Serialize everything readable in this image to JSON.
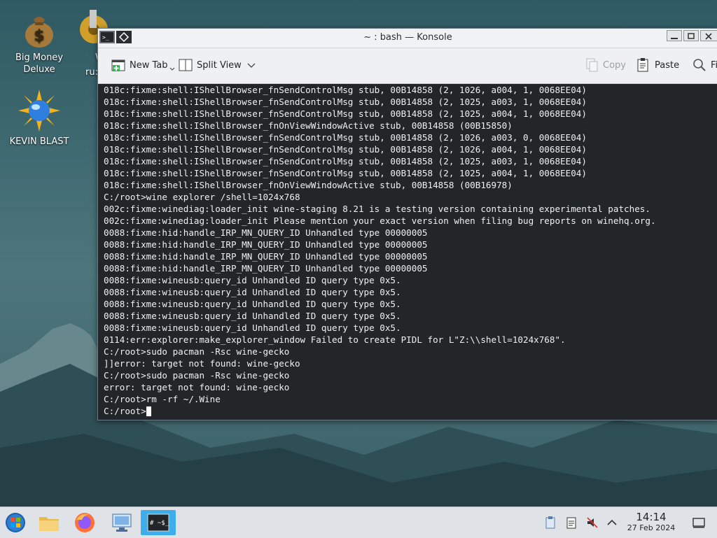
{
  "desktop": {
    "icons": [
      {
        "label_line1": "Big Money",
        "label_line2": "Deluxe"
      },
      {
        "label": "KEVIN BLAST"
      },
      {
        "label_partial": "W",
        "label_partial2": "ru:"
      }
    ]
  },
  "window": {
    "title": "~ : bash — Konsole",
    "toolbar": {
      "new_tab": "New Tab",
      "split_view": "Split View",
      "copy": "Copy",
      "paste": "Paste",
      "find": "Fi"
    }
  },
  "terminal": {
    "lines": [
      "018c:fixme:shell:IShellBrowser_fnSendControlMsg stub, 00B14858 (2, 1026, a004, 1, 0068EE04)",
      "018c:fixme:shell:IShellBrowser_fnSendControlMsg stub, 00B14858 (2, 1025, a003, 1, 0068EE04)",
      "018c:fixme:shell:IShellBrowser_fnSendControlMsg stub, 00B14858 (2, 1025, a004, 1, 0068EE04)",
      "018c:fixme:shell:IShellBrowser_fnOnViewWindowActive stub, 00B14858 (00B15850)",
      "018c:fixme:shell:IShellBrowser_fnSendControlMsg stub, 00B14858 (2, 1026, a003, 0, 0068EE04)",
      "018c:fixme:shell:IShellBrowser_fnSendControlMsg stub, 00B14858 (2, 1026, a004, 1, 0068EE04)",
      "018c:fixme:shell:IShellBrowser_fnSendControlMsg stub, 00B14858 (2, 1025, a003, 1, 0068EE04)",
      "018c:fixme:shell:IShellBrowser_fnSendControlMsg stub, 00B14858 (2, 1025, a004, 1, 0068EE04)",
      "018c:fixme:shell:IShellBrowser_fnOnViewWindowActive stub, 00B14858 (00B16978)",
      "C:/root>wine explorer /shell=1024x768",
      "002c:fixme:winediag:loader_init wine-staging 8.21 is a testing version containing experimental patches.",
      "002c:fixme:winediag:loader_init Please mention your exact version when filing bug reports on winehq.org.",
      "0088:fixme:hid:handle_IRP_MN_QUERY_ID Unhandled type 00000005",
      "0088:fixme:hid:handle_IRP_MN_QUERY_ID Unhandled type 00000005",
      "0088:fixme:hid:handle_IRP_MN_QUERY_ID Unhandled type 00000005",
      "0088:fixme:hid:handle_IRP_MN_QUERY_ID Unhandled type 00000005",
      "0088:fixme:wineusb:query_id Unhandled ID query type 0x5.",
      "0088:fixme:wineusb:query_id Unhandled ID query type 0x5.",
      "0088:fixme:wineusb:query_id Unhandled ID query type 0x5.",
      "0088:fixme:wineusb:query_id Unhandled ID query type 0x5.",
      "0088:fixme:wineusb:query_id Unhandled ID query type 0x5.",
      "0114:err:explorer:make_explorer_window Failed to create PIDL for L\"Z:\\\\shell=1024x768\".",
      "C:/root>sudo pacman -Rsc wine-gecko",
      "]]error: target not found: wine-gecko",
      "C:/root>sudo pacman -Rsc wine-gecko",
      "error: target not found: wine-gecko",
      "C:/root>rm -rf ~/.Wine"
    ],
    "prompt": "C:/root>"
  },
  "taskbar": {
    "time": "14:14",
    "date": "27 Feb 2024",
    "terminal_task_label": "# ~$_"
  },
  "colors": {
    "accent": "#3daee9",
    "terminal_bg": "#232629",
    "terminal_fg": "#eff0f1"
  }
}
